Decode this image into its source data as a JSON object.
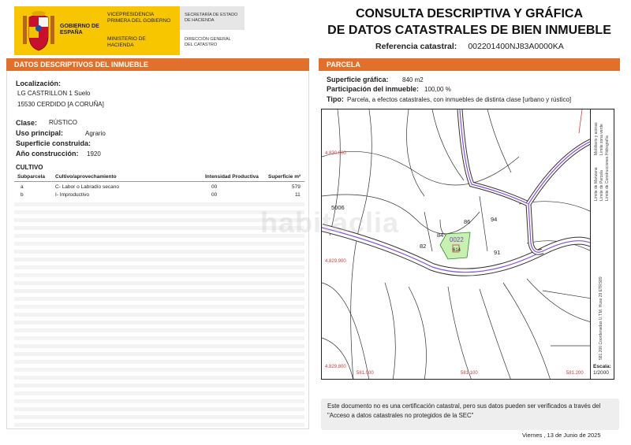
{
  "header": {
    "gobierno": "GOBIERNO DE ESPAÑA",
    "vicepresidencia": "VICEPRESIDENCIA PRIMERA DEL GOBIERNO",
    "ministerio": "MINISTERIO DE HACIENDA",
    "secretaria": "SECRETARÍA DE ESTADO DE HACIENDA",
    "direccion": "DIRECCIÓN GENERAL DEL CATASTRO",
    "title_line1": "CONSULTA DESCRIPTIVA Y GRÁFICA",
    "title_line2": "DE DATOS CATASTRALES DE BIEN INMUEBLE",
    "ref_label": "Referencia catastral:",
    "ref_value": "002201400NJ83A0000KA"
  },
  "left": {
    "section_title": "DATOS DESCRIPTIVOS DEL INMUEBLE",
    "localizacion_label": "Localización:",
    "localizacion_line1": "LG CASTRILLON 1 Suelo",
    "localizacion_line2": "15530 CERDIDO [A CORUÑA]",
    "clase_label": "Clase:",
    "clase_value": "RÚSTICO",
    "uso_label": "Uso principal:",
    "uso_value": "Agrario",
    "superficie_label": "Superficie construida:",
    "anio_label": "Año construcción:",
    "anio_value": "1920",
    "cultivo_title": "CULTIVO",
    "table": {
      "headers": [
        "Subparcela",
        "Cultivo/aprovechamiento",
        "Intensidad Productiva",
        "Superficie m²"
      ],
      "rows": [
        [
          "a",
          "C- Labor o Labradío secano",
          "00",
          "579"
        ],
        [
          "b",
          "I- Improductivo",
          "00",
          "11"
        ]
      ]
    }
  },
  "right": {
    "section_title": "PARCELA",
    "superficie_label": "Superficie gráfica:",
    "superficie_value": "840 m2",
    "participacion_label": "Participación del inmueble:",
    "participacion_value": "100,00 %",
    "tipo_label": "Tipo:",
    "tipo_value": "Parcela, a efectos catastrales, con inmuebles de distinta clase [urbano y rústico]",
    "map": {
      "coord_y1": "4.830.000",
      "coord_y2": "4.829.900",
      "coord_y3": "4.829.800",
      "coord_x1": "581.000",
      "coord_x2": "581.100",
      "coord_x3": "581.200",
      "parcel_labels": [
        "5006",
        "86",
        "94",
        "84",
        "82",
        "91"
      ],
      "parcel_highlight": "0022",
      "parcel_highlight_sub": "614"
    },
    "legend": {
      "items": [
        "Límite de Manzana",
        "Límite de Parcela",
        "Límite de Construcciones",
        "Mobiliario y aceras",
        "Límite zona verde",
        "Hidrografía"
      ],
      "coordinates": "581.200 Coordenadas U.T.M. Huso 29 ETRS89",
      "escala_label": "Escala:",
      "escala_value": "1/2000"
    },
    "note": "Este documento no es una certificación catastral, pero sus datos pueden ser verificados a través del \"Acceso a datos catastrales no protegidos de la SEC\"",
    "date": "Viernes , 13 de Junio de 2025"
  },
  "watermark": "habitaclia",
  "colors": {
    "accent": "#e0702b",
    "header_yellow": "#f7c600",
    "parcel_fill": "#c8f0b0",
    "road_purple": "#8a4fd8"
  }
}
